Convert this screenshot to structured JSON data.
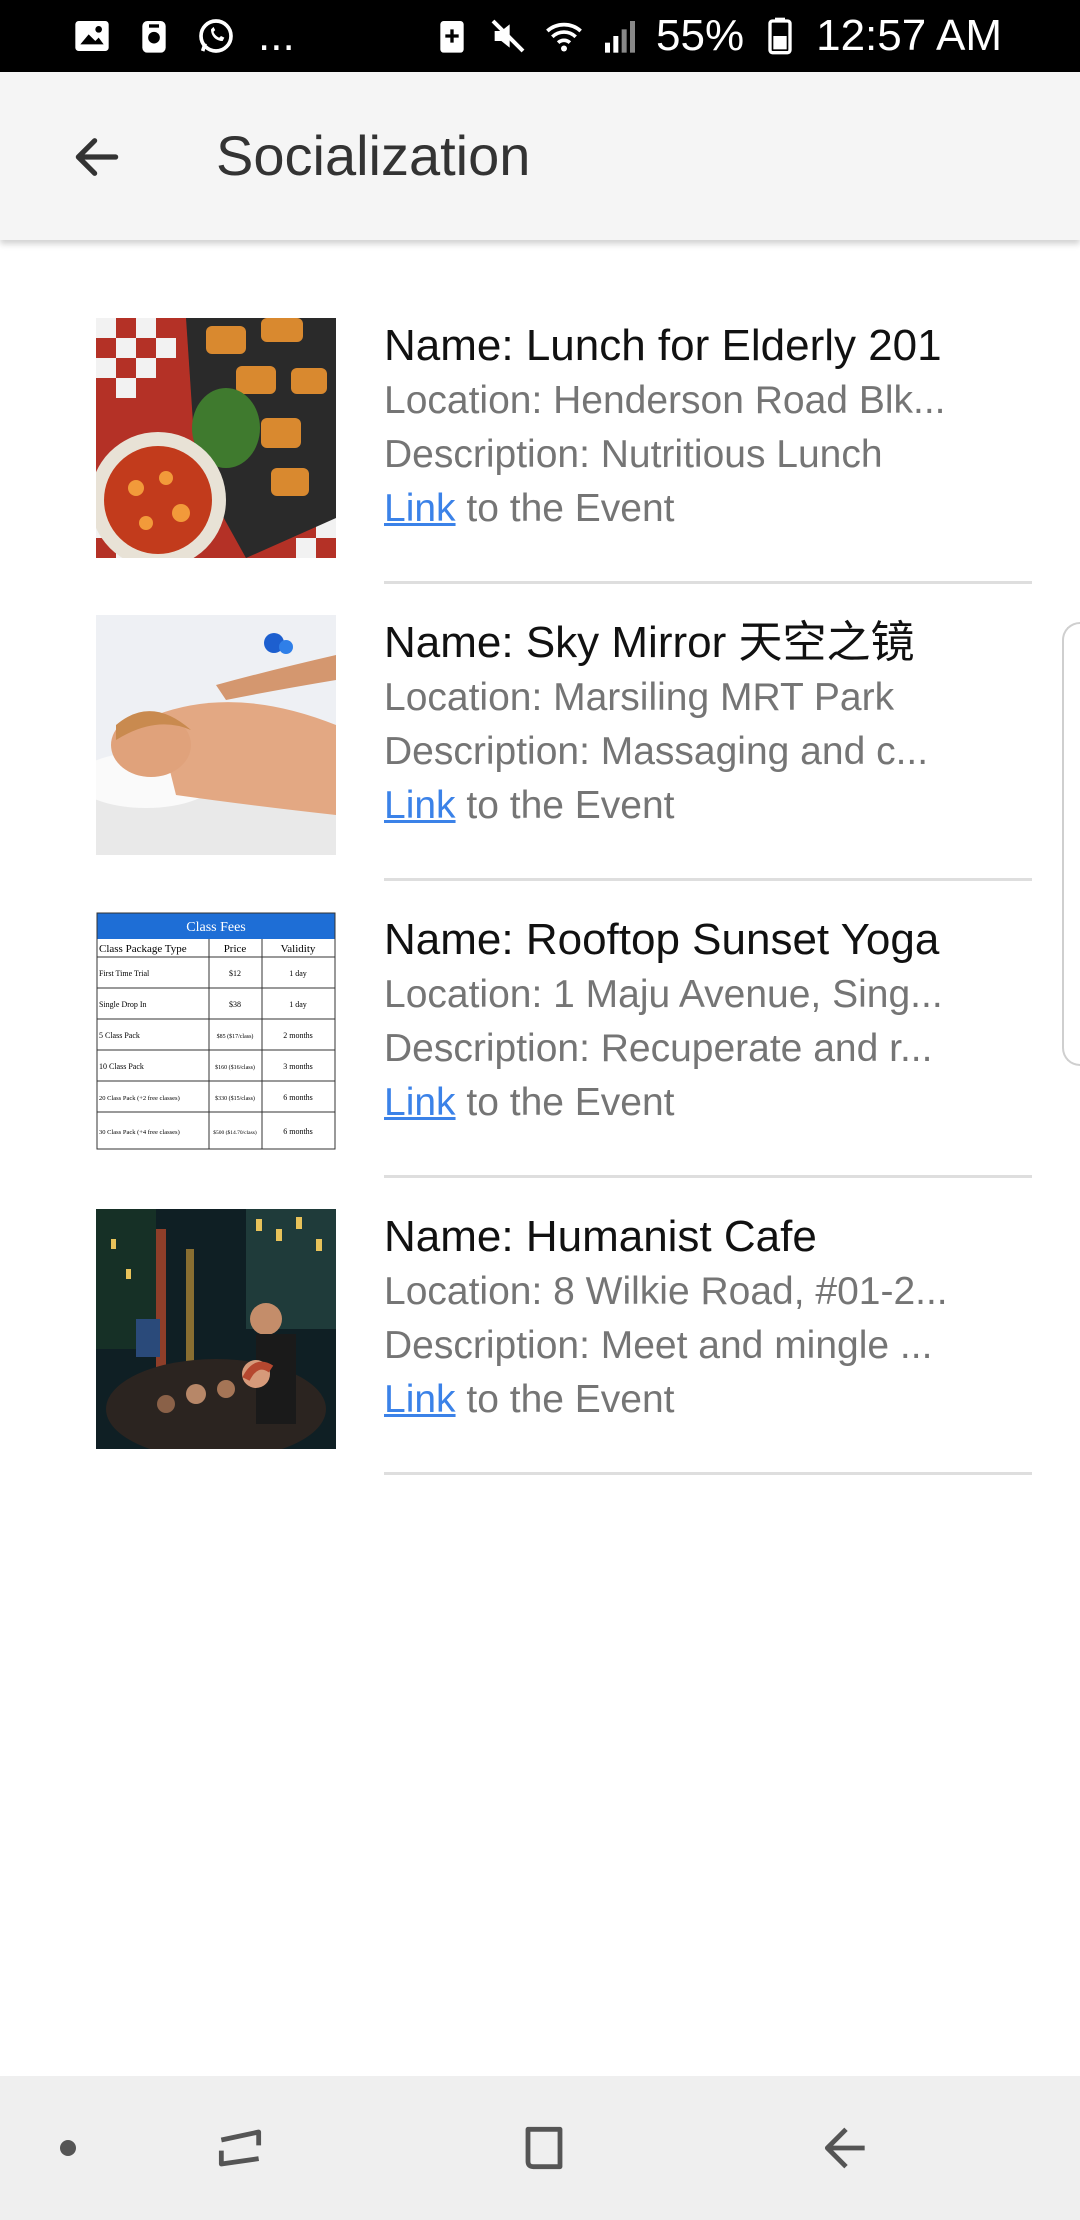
{
  "status_bar": {
    "left_icons": [
      "gallery-icon",
      "lock-badge-icon",
      "whatsapp-icon"
    ],
    "more": "...",
    "right_icons": [
      "battery-saver-icon",
      "mute-icon",
      "wifi-icon",
      "signal-icon"
    ],
    "battery": "55%",
    "time": "12:57 AM"
  },
  "app_bar": {
    "title": "Socialization"
  },
  "events": [
    {
      "name": "Name: Lunch for Elderly 201",
      "location": "Location: Henderson Road Blk...",
      "description": "Description: Nutritious Lunch",
      "link_label": "Link",
      "link_suffix": " to the Event",
      "image": "food-photo"
    },
    {
      "name": "Name: Sky Mirror 天空之镜",
      "location": "Location: Marsiling MRT Park",
      "description": "Description: Massaging and c...",
      "link_label": "Link",
      "link_suffix": " to the Event",
      "image": "massage-photo"
    },
    {
      "name": "Name: Rooftop Sunset Yoga",
      "location": "Location: 1 Maju Avenue, Sing...",
      "description": "Description: Recuperate and r...",
      "link_label": "Link",
      "link_suffix": " to the Event",
      "image": "class-fees-table",
      "fees_table": {
        "title": "Class Fees",
        "headers": [
          "Class Package Type",
          "Price",
          "Validity"
        ],
        "rows": [
          [
            "First Time Trial",
            "$12",
            "1 day"
          ],
          [
            "Single Drop In",
            "$38",
            "1 day"
          ],
          [
            "5 Class Pack",
            "$85 ($17/class)",
            "2 months"
          ],
          [
            "10 Class Pack",
            "$160 ($16/class)",
            "3 months"
          ],
          [
            "20 Class Pack (+2 free classes)",
            "$330 ($15/class)",
            "6 months"
          ],
          [
            "30 Class Pack (+4 free classes)",
            "$500 ($14.70/class)",
            "6 months"
          ]
        ]
      }
    },
    {
      "name": "Name: Humanist Cafe",
      "location": "Location: 8 Wilkie Road, #01-2...",
      "description": "Description: Meet and mingle ...",
      "link_label": "Link",
      "link_suffix": " to the Event",
      "image": "crowd-photo"
    }
  ],
  "nav_bar": {
    "buttons": [
      "dot-button",
      "recent-apps-button",
      "home-button",
      "back-button"
    ]
  },
  "colors": {
    "link": "#3b82e8",
    "app_bar": "#f5f5f5",
    "secondary_text": "#757575"
  }
}
